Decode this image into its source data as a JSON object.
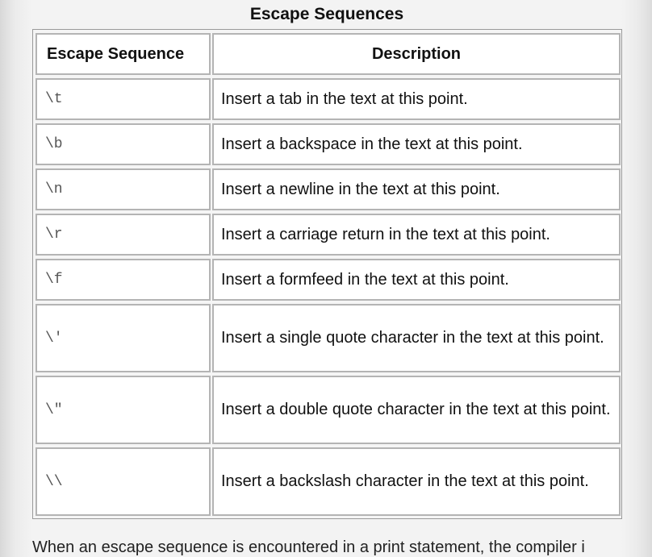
{
  "table": {
    "caption": "Escape Sequences",
    "headers": {
      "sequence": "Escape Sequence",
      "description": "Description"
    },
    "rows": [
      {
        "sequence": "\\t",
        "description": "Insert a tab in the text at this point."
      },
      {
        "sequence": "\\b",
        "description": "Insert a backspace in the text at this point."
      },
      {
        "sequence": "\\n",
        "description": "Insert a newline in the text at this point."
      },
      {
        "sequence": "\\r",
        "description": "Insert a carriage return in the text at this point."
      },
      {
        "sequence": "\\f",
        "description": "Insert a formfeed in the text at this point."
      },
      {
        "sequence": "\\'",
        "description": "Insert a single quote character in the text at this point."
      },
      {
        "sequence": "\\\"",
        "description": "Insert a double quote character in the text at this point."
      },
      {
        "sequence": "\\\\",
        "description": "Insert a backslash character in the text at this point."
      }
    ]
  },
  "footer": {
    "text": "When an escape sequence is encountered in a print statement, the compiler i"
  }
}
